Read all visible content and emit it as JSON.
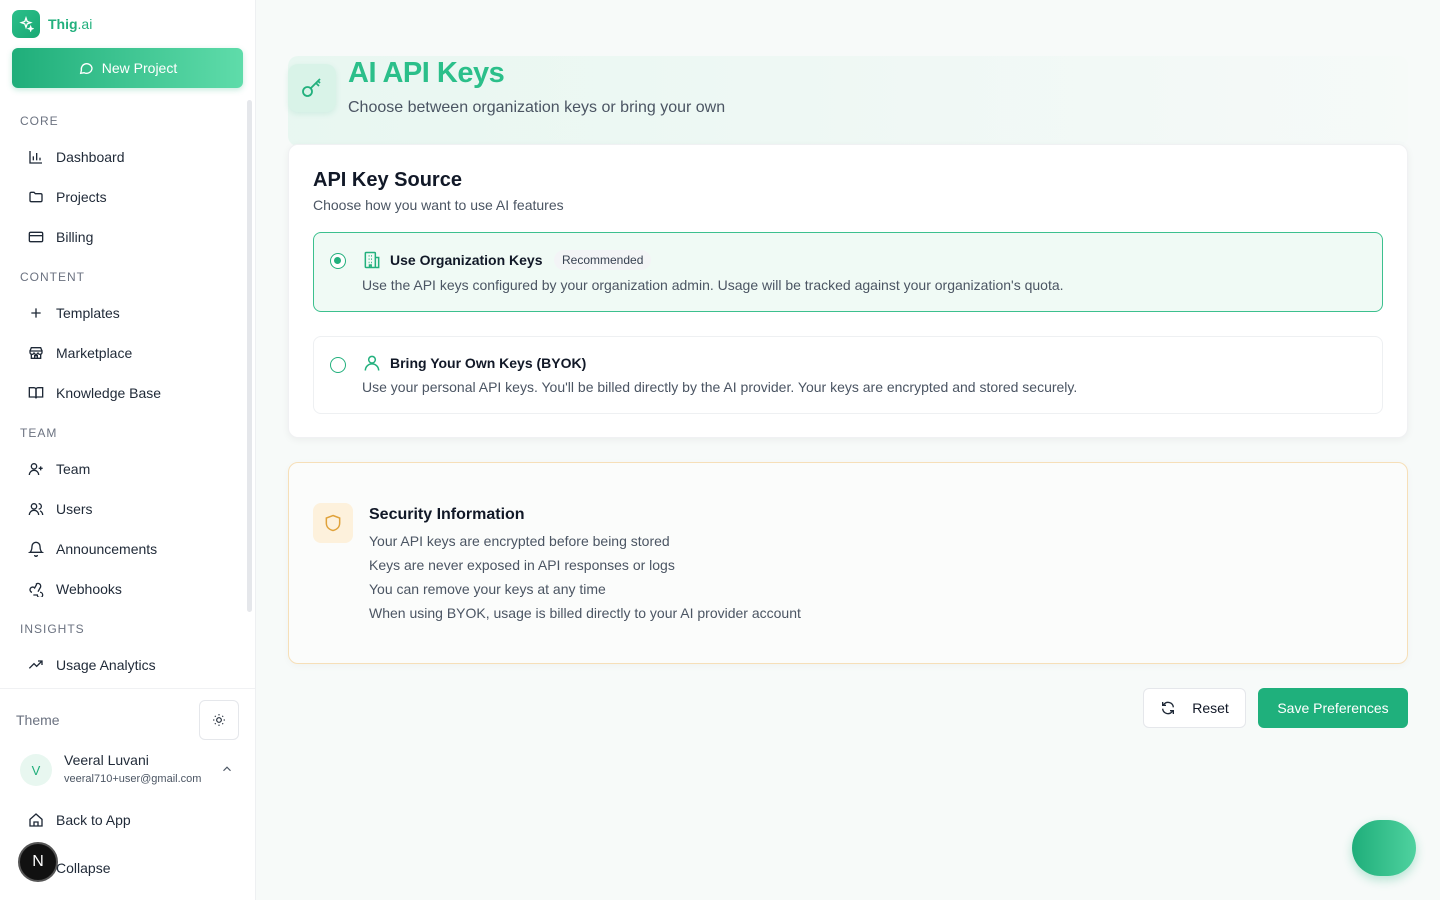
{
  "brand": {
    "name": "Thig",
    "suffix": ".ai"
  },
  "sidebar": {
    "new_project_label": "New Project",
    "sections": [
      {
        "label": "CORE",
        "items": [
          {
            "label": "Dashboard",
            "icon": "bar-chart-icon"
          },
          {
            "label": "Projects",
            "icon": "folder-icon"
          },
          {
            "label": "Billing",
            "icon": "credit-card-icon"
          }
        ]
      },
      {
        "label": "CONTENT",
        "items": [
          {
            "label": "Templates",
            "icon": "plus-icon"
          },
          {
            "label": "Marketplace",
            "icon": "store-icon"
          },
          {
            "label": "Knowledge Base",
            "icon": "book-icon"
          }
        ]
      },
      {
        "label": "TEAM",
        "items": [
          {
            "label": "Team",
            "icon": "user-plus-icon"
          },
          {
            "label": "Users",
            "icon": "users-icon"
          },
          {
            "label": "Announcements",
            "icon": "bell-icon"
          },
          {
            "label": "Webhooks",
            "icon": "webhook-icon"
          }
        ]
      },
      {
        "label": "INSIGHTS",
        "items": [
          {
            "label": "Usage Analytics",
            "icon": "trending-up-icon"
          }
        ]
      }
    ],
    "theme_label": "Theme",
    "user": {
      "initial": "V",
      "name": "Veeral Luvani",
      "email": "veeral710+user@gmail.com"
    },
    "back_to_app": "Back to App",
    "collapse": "Collapse",
    "n_badge": "N"
  },
  "header": {
    "title": "AI API Keys",
    "subtitle": "Choose between organization keys or bring your own"
  },
  "key_source": {
    "title": "API Key Source",
    "subtitle": "Choose how you want to use AI features",
    "options": [
      {
        "title": "Use Organization Keys",
        "badge": "Recommended",
        "description": "Use the API keys configured by your organization admin. Usage will be tracked against your organization's quota.",
        "selected": true
      },
      {
        "title": "Bring Your Own Keys (BYOK)",
        "description": "Use your personal API keys. You'll be billed directly by the AI provider. Your keys are encrypted and stored securely.",
        "selected": false
      }
    ]
  },
  "security": {
    "title": "Security Information",
    "lines": [
      "Your API keys are encrypted before being stored",
      "Keys are never exposed in API responses or logs",
      "You can remove your keys at any time",
      "When using BYOK, usage is billed directly to your AI provider account"
    ]
  },
  "actions": {
    "reset_label": "Reset",
    "save_label": "Save Preferences"
  },
  "colors": {
    "accent": "#1fb07c",
    "accent_light": "#2bbf8a",
    "warning_border": "#f6dfb8"
  }
}
